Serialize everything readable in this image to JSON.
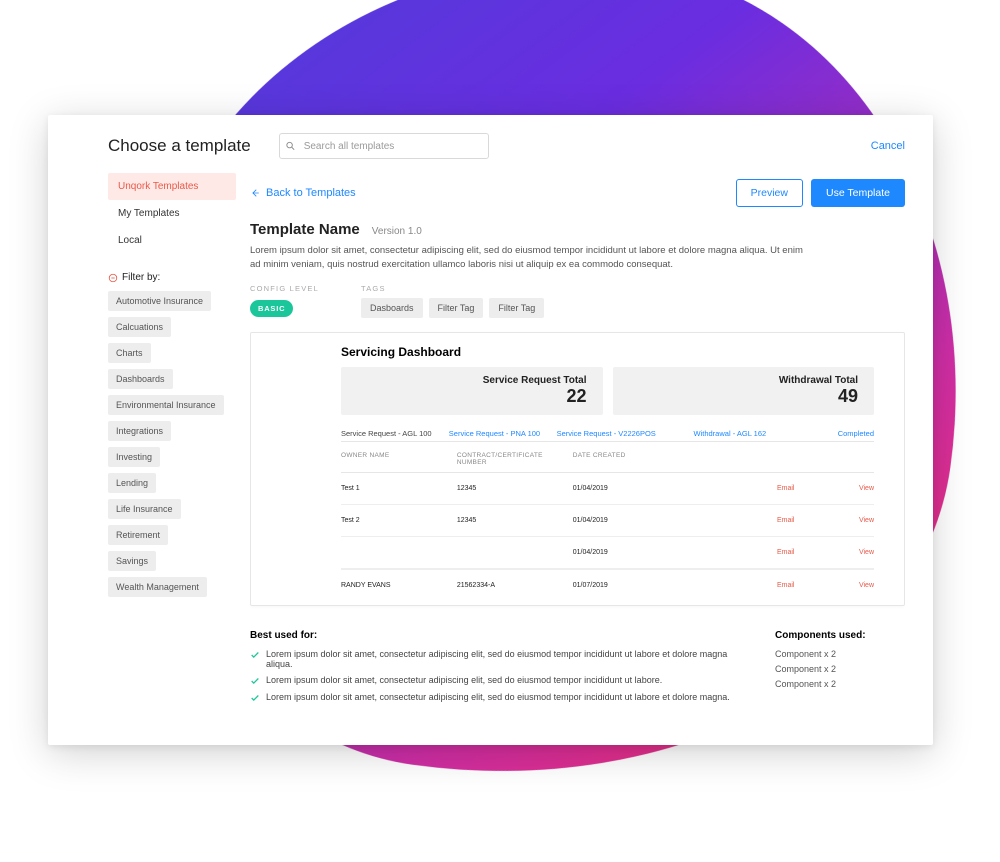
{
  "header": {
    "title": "Choose a template",
    "search_placeholder": "Search all templates",
    "cancel": "Cancel"
  },
  "sidebar": {
    "tabs": [
      {
        "label": "Unqork Templates",
        "active": true
      },
      {
        "label": "My Templates",
        "active": false
      },
      {
        "label": "Local",
        "active": false
      }
    ],
    "filter_label": "Filter by:",
    "filters": [
      "Automotive Insurance",
      "Calcuations",
      "Charts",
      "Dashboards",
      "Environmental Insurance",
      "Integrations",
      "Investing",
      "Lending",
      "Life Insurance",
      "Retirement",
      "Savings",
      "Wealth Management"
    ]
  },
  "main": {
    "back": "Back to Templates",
    "preview_btn": "Preview",
    "use_btn": "Use Template",
    "name": "Template Name",
    "version": "Version 1.0",
    "desc": "Lorem ipsum dolor sit amet, consectetur adipiscing elit, sed do eiusmod tempor incididunt ut labore et dolore magna aliqua. Ut enim ad minim veniam, quis nostrud exercitation ullamco laboris nisi ut aliquip ex ea commodo consequat.",
    "config_label": "CONFIG LEVEL",
    "config_value": "BASIC",
    "tags_label": "TAGS",
    "tags": [
      "Dasboards",
      "Filter Tag",
      "Filter Tag"
    ]
  },
  "preview": {
    "title": "Servicing Dashboard",
    "stats": [
      {
        "label": "Service Request Total",
        "value": "22"
      },
      {
        "label": "Withdrawal Total",
        "value": "49"
      }
    ],
    "tabs": [
      "Service Request - AGL 100",
      "Service Request - PNA 100",
      "Service Request - V2226POS",
      "Withdrawal - AGL 162",
      "Completed"
    ],
    "columns": [
      "OWNER NAME",
      "CONTRACT/CERTIFICATE NUMBER",
      "DATE CREATED"
    ],
    "email": "Email",
    "view": "View",
    "rows": [
      {
        "owner": "Test 1",
        "contract": "12345",
        "date": "01/04/2019"
      },
      {
        "owner": "Test 2",
        "contract": "12345",
        "date": "01/04/2019"
      },
      {
        "owner": "",
        "contract": "",
        "date": "01/04/2019"
      },
      {
        "owner": "RANDY EVANS",
        "contract": "21562334-A",
        "date": "01/07/2019"
      }
    ]
  },
  "bottom": {
    "best_title": "Best used for:",
    "best_items": [
      "Lorem ipsum dolor sit amet, consectetur adipiscing elit, sed do eiusmod tempor incididunt ut labore et dolore magna aliqua.",
      "Lorem ipsum dolor sit amet, consectetur adipiscing elit, sed do eiusmod tempor incididunt ut labore.",
      "Lorem ipsum dolor sit amet, consectetur adipiscing elit, sed do eiusmod tempor incididunt ut labore et dolore magna."
    ],
    "components_title": "Components used:",
    "components": [
      "Component x 2",
      "Component x 2",
      "Component x 2"
    ]
  }
}
